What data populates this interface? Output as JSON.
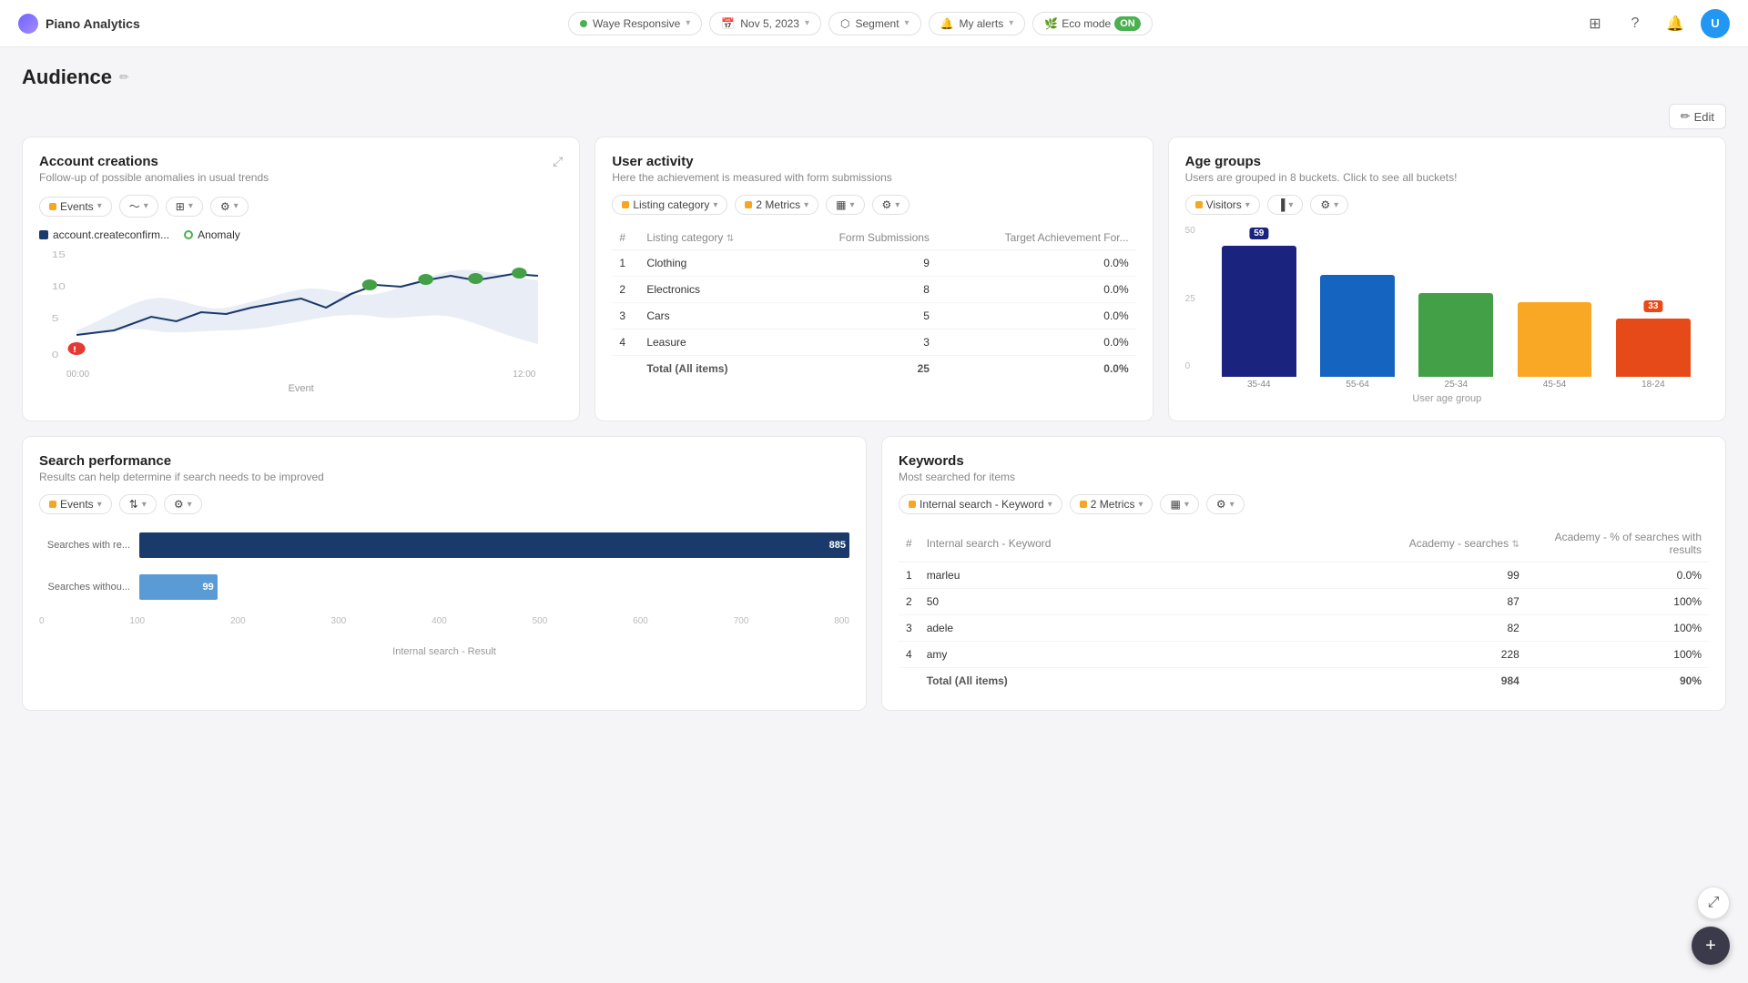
{
  "brand": {
    "name": "Piano Analytics"
  },
  "topnav": {
    "site": "Waye Responsive",
    "date": "Nov 5, 2023",
    "segment": "Segment",
    "alerts": "My alerts",
    "eco_label": "Eco mode",
    "eco_status": "ON",
    "edit_btn": "Edit"
  },
  "page": {
    "title": "Audience"
  },
  "account_creations": {
    "title": "Account creations",
    "subtitle": "Follow-up of possible anomalies in usual trends",
    "filter_label": "Events",
    "legend_series": "account.createconfirm...",
    "legend_anomaly": "Anomaly",
    "x_labels": [
      "00:00",
      "12:00"
    ],
    "x_title": "Event",
    "y_labels": [
      "15",
      "10",
      "5",
      "0"
    ],
    "anomaly_point_value": "1"
  },
  "user_activity": {
    "title": "User activity",
    "subtitle": "Here the achievement is measured with form submissions",
    "filter_label": "Listing category",
    "metrics_label": "2 Metrics",
    "col_listing": "Listing category",
    "col_submissions": "Form Submissions",
    "col_target": "Target Achievement For...",
    "rows": [
      {
        "num": 1,
        "name": "Clothing",
        "submissions": 9,
        "target": "0.0%"
      },
      {
        "num": 2,
        "name": "Electronics",
        "submissions": 8,
        "target": "0.0%"
      },
      {
        "num": 3,
        "name": "Cars",
        "submissions": 5,
        "target": "0.0%"
      },
      {
        "num": 4,
        "name": "Leasure",
        "submissions": 3,
        "target": "0.0%"
      }
    ],
    "total_label": "Total (All items)",
    "total_submissions": 25,
    "total_target": "0.0%"
  },
  "age_groups": {
    "title": "Age groups",
    "subtitle": "Users are grouped in 8 buckets. Click to see all buckets!",
    "filter_label": "Visitors",
    "x_title": "User age group",
    "y_labels": [
      "50",
      "25",
      "0"
    ],
    "bars": [
      {
        "label": "35-44",
        "value": 59,
        "height_pct": 90,
        "color": "#1a237e",
        "highlight": true
      },
      {
        "label": "55-64",
        "value": null,
        "height_pct": 75,
        "color": "#1565c0",
        "highlight": false
      },
      {
        "label": "25-34",
        "value": null,
        "height_pct": 60,
        "color": "#43a047",
        "highlight": false
      },
      {
        "label": "45-54",
        "value": null,
        "height_pct": 55,
        "color": "#f9a825",
        "highlight": false
      },
      {
        "label": "18-24",
        "value": 33,
        "height_pct": 42,
        "color": "#e64a19",
        "highlight": true
      }
    ]
  },
  "search_performance": {
    "title": "Search performance",
    "subtitle": "Results can help determine if search needs to be improved",
    "filter_label": "Events",
    "x_labels": [
      "0",
      "100",
      "200",
      "300",
      "400",
      "500",
      "600",
      "700",
      "800"
    ],
    "x_title": "Internal search - Result",
    "bars": [
      {
        "label": "Searches with re...",
        "value": 885,
        "pct": 100,
        "color": "#1a3a6b"
      },
      {
        "label": "Searches withou...",
        "value": 99,
        "pct": 11,
        "color": "#5b9bd5"
      }
    ]
  },
  "keywords": {
    "title": "Keywords",
    "subtitle": "Most searched for items",
    "filter_label": "Internal search - Keyword",
    "metrics_label": "2 Metrics",
    "col_keyword": "Internal search - Keyword",
    "col_searches": "Academy - searches",
    "col_pct": "Academy - % of searches with results",
    "rows": [
      {
        "num": 1,
        "keyword": "marleu",
        "searches": 99,
        "pct": "0.0%"
      },
      {
        "num": 2,
        "keyword": "50",
        "searches": 87,
        "pct": "100%"
      },
      {
        "num": 3,
        "keyword": "adele",
        "searches": 82,
        "pct": "100%"
      },
      {
        "num": 4,
        "keyword": "amy",
        "searches": 228,
        "pct": "100%"
      }
    ],
    "total_label": "Total (All items)",
    "total_searches": 984,
    "total_pct": "90%"
  }
}
